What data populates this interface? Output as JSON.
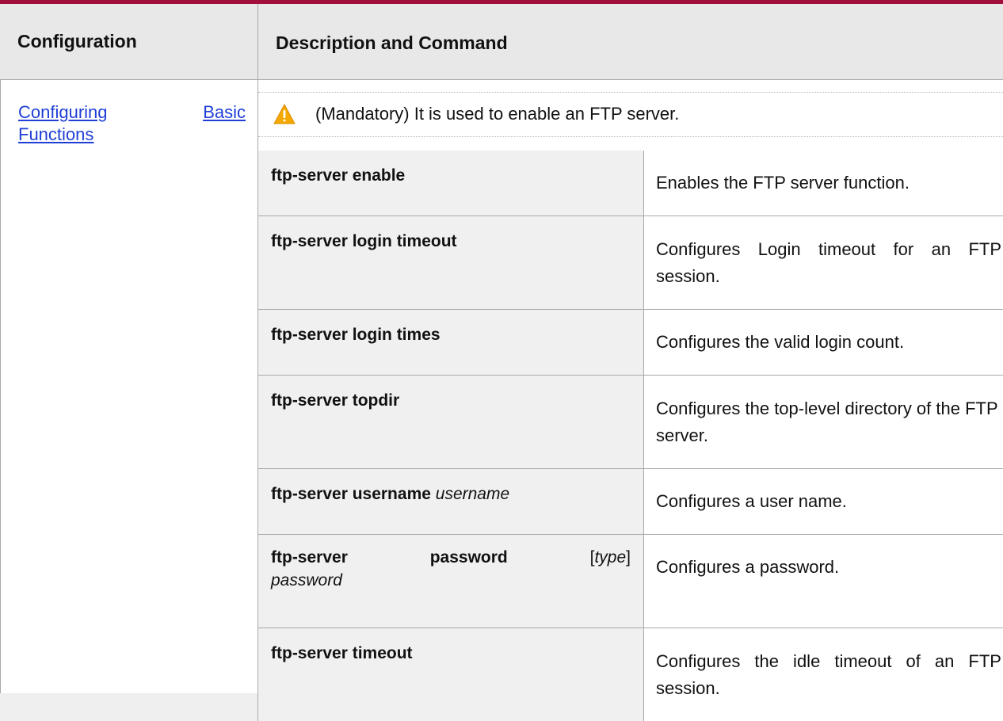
{
  "header": {
    "configuration": "Configuration",
    "description": "Description and Command"
  },
  "left": {
    "link_word1": "Configuring",
    "link_word2": "Basic",
    "link_word3": "Functions"
  },
  "mandatory_note": "(Mandatory) It is used to enable an FTP server.",
  "icons": {
    "warning": "warning-triangle-icon"
  },
  "colors": {
    "accent_bar": "#a30f3c",
    "link": "#1f3fd6",
    "warning": "#f5a800"
  },
  "rows": [
    {
      "cmd": "ftp-server enable",
      "desc": "Enables the FTP server function."
    },
    {
      "cmd": "ftp-server login timeout",
      "desc": "Configures Login timeout for an FTP session."
    },
    {
      "cmd": "ftp-server login times",
      "desc": "Configures the valid login count."
    },
    {
      "cmd": "ftp-server topdir",
      "desc": "Configures the top-level directory of the FTP server."
    },
    {
      "cmd_bold": "ftp-server username",
      "cmd_italic": "username",
      "desc": "Configures a user name."
    },
    {
      "cmd_bold1": "ftp-server",
      "cmd_bold2": "password",
      "cmd_bracket_open": "[",
      "cmd_type": "type",
      "cmd_bracket_close": "]",
      "cmd_italic2": "password",
      "desc": "Configures a password."
    },
    {
      "cmd": "ftp-server timeout",
      "desc": "Configures the idle timeout of an FTP session."
    }
  ]
}
